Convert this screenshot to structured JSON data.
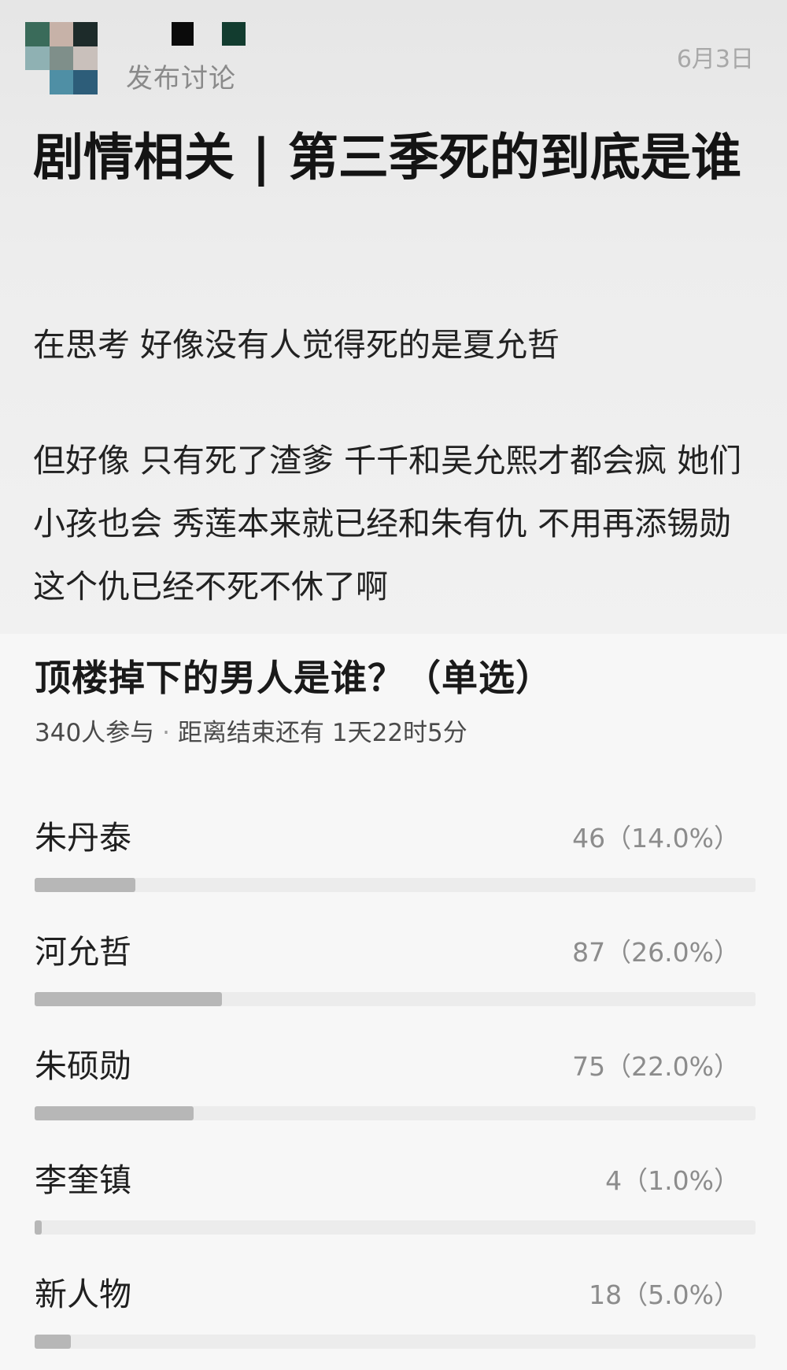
{
  "post": {
    "subtitle": "发布讨论",
    "date": "6月3日",
    "title": "剧情相关 | 第三季死的到底是谁",
    "paragraphs": [
      "在思考 好像没有人觉得死的是夏允哲",
      "但好像 只有死了渣爹 千千和吴允熙才都会疯 她们小孩也会  秀莲本来就已经和朱有仇 不用再添锡勋这个仇已经不死不休了啊"
    ]
  },
  "poll": {
    "title": "顶楼掉下的男人是谁？（单选）",
    "participants": "340人参与",
    "separator": "·",
    "remaining": "距离结束还有 1天22时5分",
    "options": [
      {
        "label": "朱丹泰",
        "count": "46（14.0%）",
        "percent": 14.0
      },
      {
        "label": "河允哲",
        "count": "87（26.0%）",
        "percent": 26.0
      },
      {
        "label": "朱硕勋",
        "count": "75（22.0%）",
        "percent": 22.0
      },
      {
        "label": "李奎镇",
        "count": "4（1.0%）",
        "percent": 1.0
      },
      {
        "label": "新人物",
        "count": "18（5.0%）",
        "percent": 5.0
      }
    ]
  },
  "colors": {
    "bar_fill": "#b7b7b7",
    "bar_track": "#ececec"
  }
}
